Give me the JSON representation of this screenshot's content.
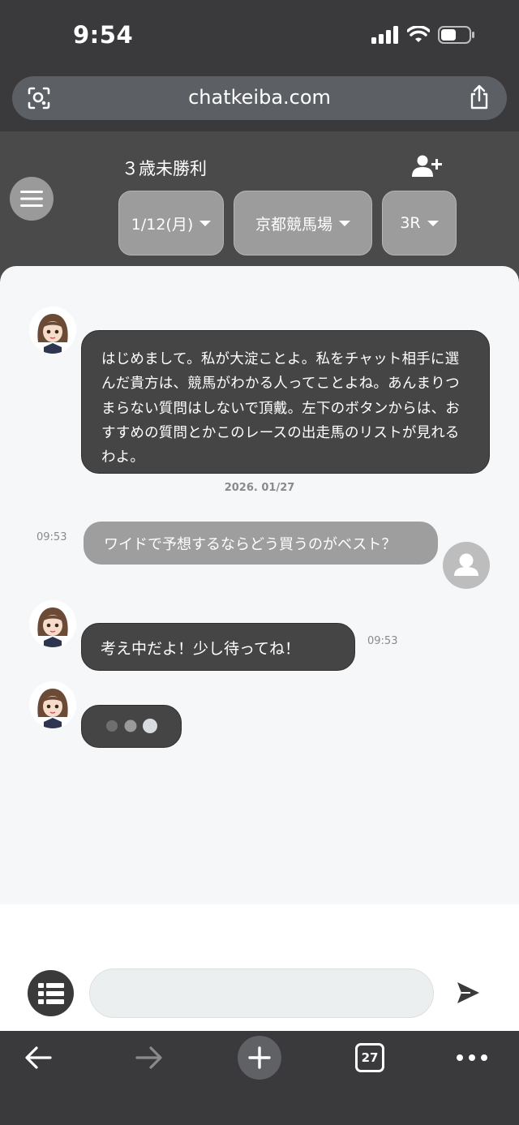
{
  "status": {
    "time": "9:54"
  },
  "browser": {
    "url": "chatkeiba.com",
    "tab_count": "27"
  },
  "header": {
    "race_title": "３歳未勝利",
    "date_select": "1/12(月)",
    "venue_select": "京都競馬場",
    "race_select": "3R"
  },
  "chat": {
    "greeting": "はじめまして。私が大淀ことよ。私をチャット相手に選んだ貴方は、競馬がわかる人ってことよね。あんまりつまらない質問はしないで頂戴。左下のボタンからは、おすすめの質問とかこのレースの出走馬のリストが見れるわよ。",
    "date": "2026. 01/27",
    "user_message": "ワイドで予想するならどう買うのがベスト？",
    "user_time": "09:53",
    "bot_reply": "考え中だよ！少し待ってね！",
    "bot_time": "09:53"
  },
  "composer": {
    "input_value": ""
  },
  "colors": {
    "dark_bg": "#3a3a3c",
    "header_bg": "#4a4a4a",
    "bot_bubble": "#454545",
    "user_bubble": "#9e9e9e",
    "chat_bg": "#f6f7f9"
  }
}
